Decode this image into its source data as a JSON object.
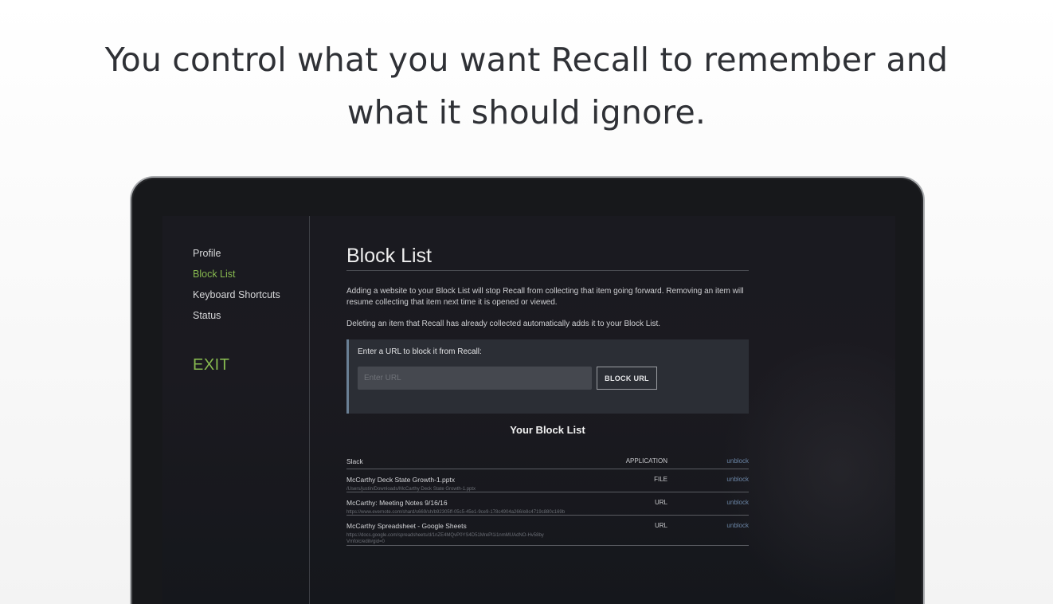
{
  "headline": {
    "line1": "You control what you want Recall to remember and",
    "line2": "what it should ignore."
  },
  "sidebar": {
    "items": [
      {
        "label": "Profile",
        "active": false
      },
      {
        "label": "Block List",
        "active": true
      },
      {
        "label": "Keyboard Shortcuts",
        "active": false
      },
      {
        "label": "Status",
        "active": false
      }
    ],
    "exit_label": "EXIT"
  },
  "main": {
    "title": "Block List",
    "description_1": "Adding a website to your Block List will stop Recall from collecting that item going forward. Removing an item will resume collecting that item next time it is opened or viewed.",
    "description_2": "Deleting an item that Recall has already collected automatically adds it to your Block List.",
    "url_panel": {
      "label": "Enter a URL to block it from Recall:",
      "placeholder": "Enter URL",
      "button_label": "BLOCK URL"
    },
    "list_heading": "Your Block List",
    "entries": [
      {
        "name": "Slack",
        "path": "",
        "type": "APPLICATION",
        "action": "unblock"
      },
      {
        "name": "McCarthy Deck State Growth-1.pptx",
        "path": "/Users/justin/Downloads/McCarthy Deck State Growth-1.pptx",
        "type": "FILE",
        "action": "unblock"
      },
      {
        "name": "McCarthy: Meeting Notes 9/16/16",
        "path": "https://www.evernote.com/shard/s669/sh/b92305ff-05c5-45e1-9ce9-178c4904a266/e8c4719c880c169b",
        "type": "URL",
        "action": "unblock"
      },
      {
        "name": "McCarthy Spreadsheet - Google Sheets",
        "path": "https://docs.google.com/spreadsheets/d/1nZE4MQvP0YS4D51MrePl1i1nmMUAdNO-Hv58byVmfolc/edit#gid=0",
        "type": "URL",
        "action": "unblock"
      }
    ]
  },
  "colors": {
    "accent_green": "#86b84f",
    "link_blue": "#6a84a4",
    "panel_bg": "#2b2e35"
  }
}
